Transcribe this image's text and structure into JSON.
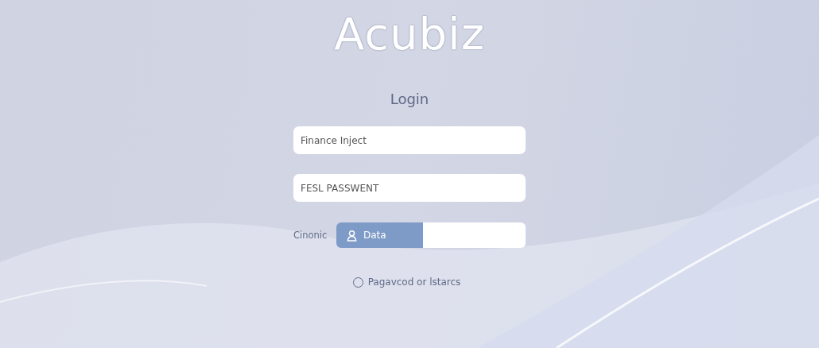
{
  "app_title": "Acubiz",
  "heading": "Login",
  "fields": [
    {
      "value": "Finance Inject"
    },
    {
      "value": "FESL PASSWENT"
    }
  ],
  "data_row": {
    "label": "Cinonic",
    "button": "Data"
  },
  "option": {
    "label": "Pagavcod or lstarcs",
    "selected": false
  }
}
